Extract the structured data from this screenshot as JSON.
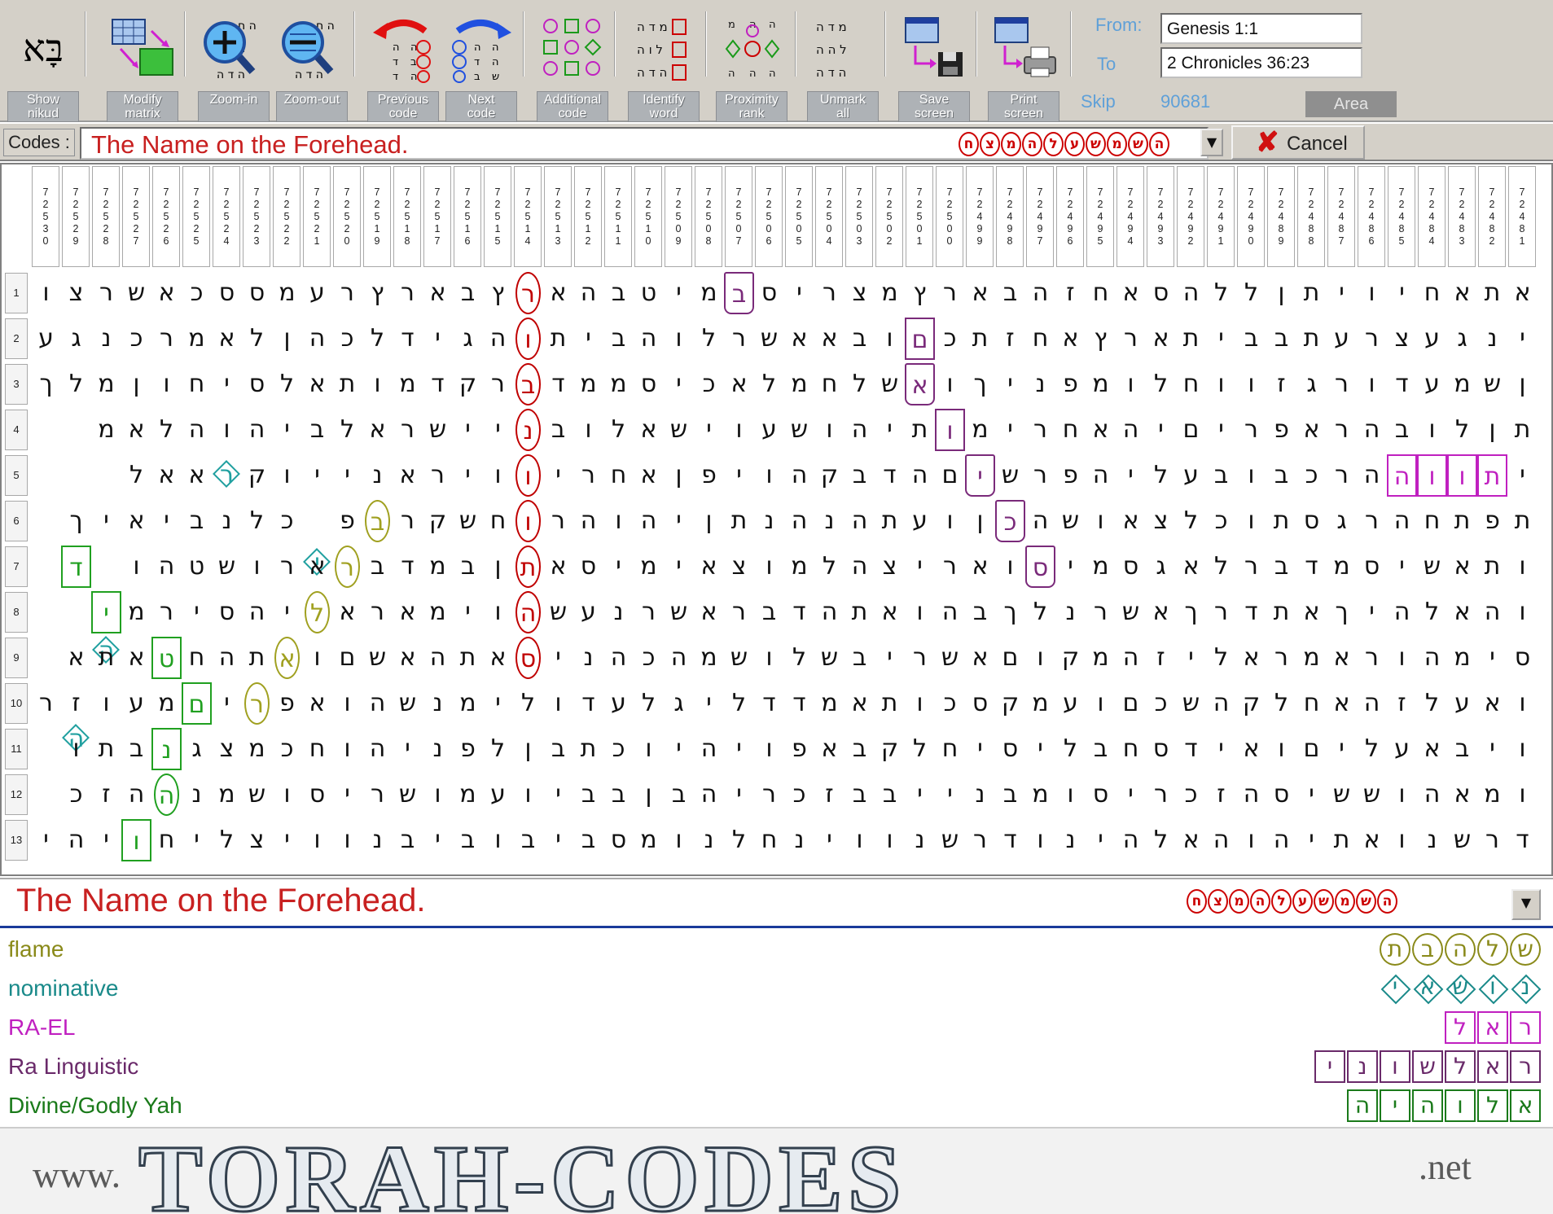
{
  "toolbar": {
    "buttons": [
      {
        "label": "Show\nnikud",
        "icon": "nikud-icon"
      },
      {
        "label": "Modify\nmatrix",
        "icon": "modify-matrix-icon"
      },
      {
        "label": "Zoom-in",
        "icon": "zoom-in-icon"
      },
      {
        "label": "Zoom-out",
        "icon": "zoom-out-icon"
      },
      {
        "label": "Previous\ncode",
        "icon": "previous-code-icon"
      },
      {
        "label": "Next\ncode",
        "icon": "next-code-icon"
      },
      {
        "label": "Additional\ncode",
        "icon": "additional-code-icon"
      },
      {
        "label": "Identify\nword",
        "icon": "identify-word-icon"
      },
      {
        "label": "Proximity\nrank",
        "icon": "proximity-rank-icon"
      },
      {
        "label": "Unmark\nall",
        "icon": "unmark-all-icon"
      },
      {
        "label": "Save\nscreen",
        "icon": "save-screen-icon"
      },
      {
        "label": "Print\nscreen",
        "icon": "print-screen-icon"
      }
    ],
    "icon_hebrew": "בָּא",
    "from_label": "From:",
    "from_value": "Genesis 1:1",
    "to_label": "To",
    "to_value": "2 Chronicles 36:23",
    "skip_label": "Skip",
    "skip_value": "90681",
    "area_label": "Area"
  },
  "codes": {
    "label": "Codes :",
    "text": "The Name on the Forehead.",
    "letters": "חצמהלעשמשה",
    "cancel_label": "Cancel"
  },
  "matrix": {
    "columns": [
      "72530",
      "72529",
      "72528",
      "72527",
      "72526",
      "72525",
      "72524",
      "72523",
      "72522",
      "72521",
      "72520",
      "72519",
      "72518",
      "72517",
      "72516",
      "72515",
      "72514",
      "72513",
      "72512",
      "72511",
      "72510",
      "72509",
      "72508",
      "72507",
      "72506",
      "72505",
      "72504",
      "72503",
      "72502",
      "72501",
      "72500",
      "72499",
      "72498",
      "72497",
      "72496",
      "72495",
      "72494",
      "72493",
      "72492",
      "72491",
      "72490",
      "72489",
      "72488",
      "72487",
      "72486",
      "72485",
      "72484",
      "72483",
      "72482",
      "72481"
    ],
    "rows": [
      "אתאחיויתןללהסאחזהבארץמצרי סבמיטבהארץבארץרעמססכאשרצו",
      "ינגעצרעתבביתארץאחזתכםובאאשרלוהביתוהגידלכהןלאמרכנגע",
      "ןשמעדורגזווחלומפניךואשלחמלאכיסממדברקדמותאלסיחוןמלך",
      "תןלובהראפריםיהאחרימותיהושעוישאלובניישראלביהוהלאמ",
      "יתווההרכבובעליהפרשיםהדבקהויפןאחריוויראנייוקראאל",
      "תפתחהרגסתוכלצאושהכןועתהנהנתןיהוהרוחשקרבפיכלנביאיך",
      "ותאשיסמדברלאגסמיסואריצהלמוצאימיסאתןבמדבראר ושטהוהד",
      "והאלהיךאתדרךאשרנלךבהואתהדבראשרנעשהוימאראליהסירמיה",
      "סימהוראמראלי זהמקוםאשריבשלושמהכהניסאתהאשםואתהחטאתא",
      "ואעלזהאחלקהשכםועמקסכותאמדדליגלעדולימנשהואפריםמעוזר",
      "ויבאעליםואידסחבליסיחלקבאפויהיוכתבןלפניהוחכמצגנבתו",
      "ומאהוששיסהזכריסומבנייבבזכריהבןבביועמושריסושמנההזכ",
      "דרשנואתיהוהאלהינודרשנווינחלנומסביבוביבנוויצליחויהי"
    ],
    "marks": [
      {
        "row": 0,
        "col": 26,
        "style": "trap",
        "color": "#7a2a7a"
      },
      {
        "row": 0,
        "col": 33,
        "style": "circle",
        "color": "#c00000"
      },
      {
        "row": 1,
        "col": 20,
        "style": "box",
        "color": "#7a2a7a"
      },
      {
        "row": 1,
        "col": 33,
        "style": "circle",
        "color": "#c00000"
      },
      {
        "row": 2,
        "col": 20,
        "style": "trap",
        "color": "#7a2a7a"
      },
      {
        "row": 2,
        "col": 33,
        "style": "circle",
        "color": "#c00000"
      },
      {
        "row": 3,
        "col": 19,
        "style": "box",
        "color": "#7a2a7a"
      },
      {
        "row": 3,
        "col": 33,
        "style": "circle",
        "color": "#c00000"
      },
      {
        "row": 4,
        "col": 1,
        "style": "box",
        "color": "#c020c0"
      },
      {
        "row": 4,
        "col": 2,
        "style": "box",
        "color": "#c020c0"
      },
      {
        "row": 4,
        "col": 3,
        "style": "box",
        "color": "#c020c0"
      },
      {
        "row": 4,
        "col": 4,
        "style": "box",
        "color": "#c020c0"
      },
      {
        "row": 4,
        "col": 18,
        "style": "trap",
        "color": "#7a2a7a"
      },
      {
        "row": 4,
        "col": 33,
        "style": "circle",
        "color": "#c00000"
      },
      {
        "row": 4,
        "col": 43,
        "style": "diamond",
        "color": "#20a0a0"
      },
      {
        "row": 5,
        "col": 17,
        "style": "trap",
        "color": "#7a2a7a"
      },
      {
        "row": 5,
        "col": 33,
        "style": "circle",
        "color": "#c00000"
      },
      {
        "row": 5,
        "col": 38,
        "style": "circle",
        "color": "#a0a020"
      },
      {
        "row": 5,
        "col": 40,
        "style": "diamond",
        "color": "#20a0a0"
      },
      {
        "row": 6,
        "col": 16,
        "style": "trap",
        "color": "#7a2a7a"
      },
      {
        "row": 6,
        "col": 33,
        "style": "circle",
        "color": "#c00000"
      },
      {
        "row": 6,
        "col": 39,
        "style": "circle",
        "color": "#a0a020"
      },
      {
        "row": 6,
        "col": 47,
        "style": "diamond",
        "color": "#20a0a0"
      },
      {
        "row": 6,
        "col": 48,
        "style": "box",
        "color": "#20a020"
      },
      {
        "row": 7,
        "col": 33,
        "style": "circle",
        "color": "#c00000"
      },
      {
        "row": 7,
        "col": 40,
        "style": "circle",
        "color": "#a0a020"
      },
      {
        "row": 7,
        "col": 47,
        "style": "box",
        "color": "#20a020"
      },
      {
        "row": 7,
        "col": 48,
        "style": "diamond",
        "color": "#20a0a0"
      },
      {
        "row": 8,
        "col": 33,
        "style": "circle",
        "color": "#c00000"
      },
      {
        "row": 8,
        "col": 41,
        "style": "circle",
        "color": "#a0a020"
      },
      {
        "row": 8,
        "col": 45,
        "style": "box",
        "color": "#20a020"
      },
      {
        "row": 8,
        "col": 49,
        "style": "diamond",
        "color": "#20a0a0"
      },
      {
        "row": 9,
        "col": 42,
        "style": "circle",
        "color": "#a0a020"
      },
      {
        "row": 9,
        "col": 44,
        "style": "box",
        "color": "#20a020"
      },
      {
        "row": 10,
        "col": 45,
        "style": "box",
        "color": "#20a020"
      },
      {
        "row": 11,
        "col": 45,
        "style": "circle",
        "color": "#20a020"
      },
      {
        "row": 12,
        "col": 46,
        "style": "box",
        "color": "#20a020"
      }
    ]
  },
  "results": {
    "title": "The Name on the Forehead.",
    "letters": "חצמהלעשמשה",
    "terms": [
      {
        "name": "flame",
        "color": "#8a8a1a",
        "letters": "שלהבת",
        "style": "circle"
      },
      {
        "name": "nominative",
        "color": "#1a8a8a",
        "letters": "נושאי",
        "style": "diamond"
      },
      {
        "name": "RA-EL",
        "color": "#c020c0",
        "letters": "ראל",
        "style": "box"
      },
      {
        "name": "Ra Linguistic",
        "color": "#6a2a6a",
        "letters": "ראלשוני",
        "style": "box"
      },
      {
        "name": "Divine/Godly Yah",
        "color": "#1a7a1a",
        "letters": "אלוהיה",
        "style": "box"
      }
    ]
  },
  "banner": {
    "www": "www.",
    "main": "TORAH-CODES",
    "net": ".net"
  },
  "colors": {
    "toolbar_bg": "#d4d0c8",
    "codes_text": "#c82020",
    "accent_blue": "#5fa0d8"
  }
}
